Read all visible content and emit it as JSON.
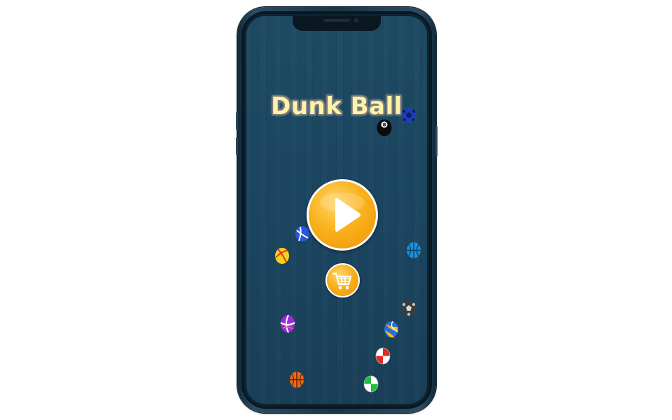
{
  "game": {
    "title": "Dunk Ball"
  },
  "buttons": {
    "play_icon": "play-icon",
    "shop_icon": "shopping-cart-icon"
  },
  "colors": {
    "background": "#1b4560",
    "button_orange": "#f9b21c",
    "title_text": "#fff3a8"
  },
  "decorative_balls": [
    {
      "name": "eight-ball",
      "icon": "billiard-eight-ball-icon",
      "label": "8"
    },
    {
      "name": "blue-soccer-ball",
      "icon": "soccer-ball-icon"
    },
    {
      "name": "blue-white-ball",
      "icon": "volleyball-icon"
    },
    {
      "name": "yellow-red-ball",
      "icon": "beach-ball-icon"
    },
    {
      "name": "blue-basketball",
      "icon": "basketball-icon"
    },
    {
      "name": "gray-soccer-ball",
      "icon": "soccer-ball-icon"
    },
    {
      "name": "purple-ball",
      "icon": "beach-ball-icon"
    },
    {
      "name": "volleyball",
      "icon": "volleyball-icon"
    },
    {
      "name": "red-white-ball",
      "icon": "beach-ball-icon"
    },
    {
      "name": "orange-basketball",
      "icon": "basketball-icon"
    },
    {
      "name": "green-white-ball",
      "icon": "beach-ball-icon"
    }
  ]
}
